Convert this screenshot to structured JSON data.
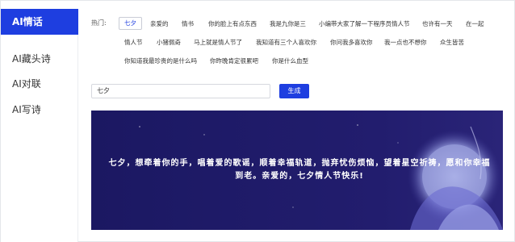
{
  "sidebar": {
    "items": [
      {
        "label": "AI情话",
        "active": true
      },
      {
        "label": "AI藏头诗",
        "active": false
      },
      {
        "label": "AI对联",
        "active": false
      },
      {
        "label": "AI写诗",
        "active": false
      }
    ]
  },
  "hot": {
    "label": "热门:",
    "tags": [
      "七夕",
      "亲爱的",
      "情书",
      "你的脸上有点东西",
      "我是九你是三",
      "小编带大家了解一下程序员情人节",
      "也许有一天",
      "在一起",
      "情人节",
      "小猪佩奇",
      "马上就是情人节了",
      "我知道有三个人喜欢你",
      "你问我多喜欢你",
      "我一点也不想你",
      "众生皆苦",
      "你知道我最珍贵的是什么吗",
      "你昨晚肯定很累吧",
      "你是什么血型"
    ]
  },
  "search": {
    "value": "七夕"
  },
  "generate_button": {
    "label": "生成"
  },
  "banner": {
    "text": "七夕，想牵着你的手，唱着爱的歌谣，顺着幸福轨道，抛弃忧伤烦恼，望着星空祈祷，愿和你幸福到老。亲爱的，七夕情人节快乐!",
    "background_color": "#1e1a66"
  },
  "colors": {
    "accent": "#1e3ee0"
  }
}
